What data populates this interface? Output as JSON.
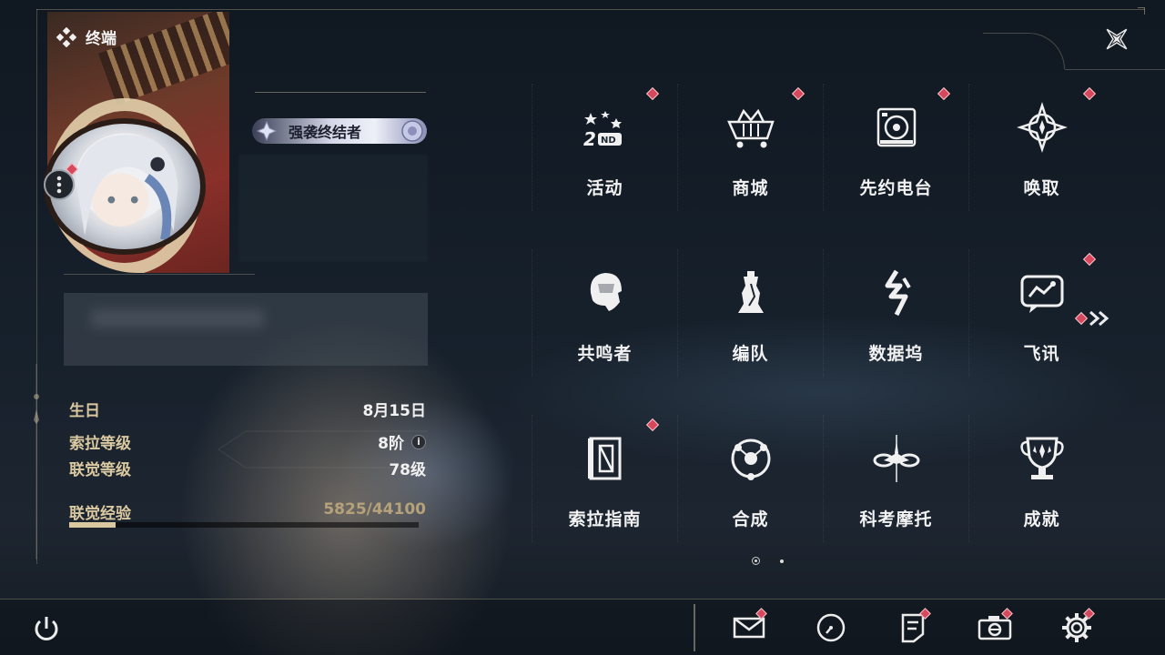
{
  "header": {
    "title": "终端",
    "title_icon": "diamond-cluster-icon",
    "close_icon": "star-close-icon"
  },
  "profile": {
    "title_badge": "强袭终结者",
    "more_icon": "more-dots-icon",
    "stats": [
      {
        "key": "生日",
        "value": "8月15日"
      },
      {
        "key": "索拉等级",
        "value": "8阶",
        "info_icon": "info-icon"
      },
      {
        "key": "联觉等级",
        "value": "78级"
      }
    ],
    "exp": {
      "label": "联觉经验",
      "value": "5825/44100",
      "progress": 0.132
    }
  },
  "menu": {
    "items": [
      {
        "label": "活动",
        "icon": "activity-2nd-anniversary-icon",
        "badge": true
      },
      {
        "label": "商城",
        "icon": "shop-basket-icon",
        "badge": true
      },
      {
        "label": "先约电台",
        "icon": "radio-speaker-icon",
        "badge": true
      },
      {
        "label": "唤取",
        "icon": "convene-compass-icon",
        "badge": true
      },
      {
        "label": "共鸣者",
        "icon": "resonator-head-icon",
        "badge": false
      },
      {
        "label": "编队",
        "icon": "team-chess-icon",
        "badge": false
      },
      {
        "label": "数据坞",
        "icon": "data-bank-icon",
        "badge": false
      },
      {
        "label": "飞讯",
        "icon": "chat-bubble-icon",
        "badge": true
      },
      {
        "label": "索拉指南",
        "icon": "guidebook-icon",
        "badge": true
      },
      {
        "label": "合成",
        "icon": "synthesis-orbit-icon",
        "badge": false
      },
      {
        "label": "科考摩托",
        "icon": "motorbike-icon",
        "badge": false
      },
      {
        "label": "成就",
        "icon": "trophy-icon",
        "badge": false
      }
    ],
    "next_icon": "double-chevron-right-icon",
    "pages": 2,
    "current_page": 1
  },
  "bottom": {
    "power_icon": "power-icon",
    "icons": [
      {
        "name": "mail-icon",
        "badge": true
      },
      {
        "name": "clock-icon",
        "badge": false
      },
      {
        "name": "notes-icon",
        "badge": true
      },
      {
        "name": "camera-icon",
        "badge": true
      },
      {
        "name": "gear-icon",
        "badge": true
      }
    ]
  },
  "colors": {
    "accent_gold": "#d9c8a0",
    "badge_red": "#d8485c",
    "text_white": "#f2f2f2"
  }
}
